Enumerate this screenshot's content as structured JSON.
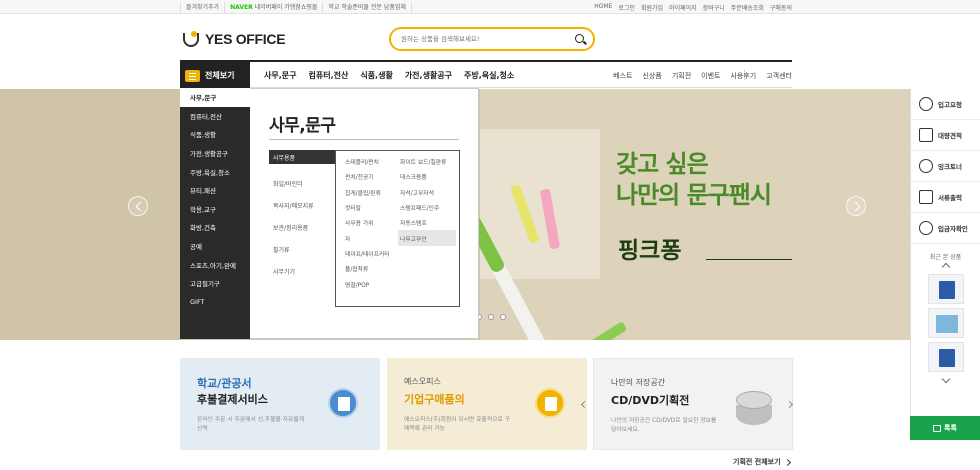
{
  "topbar": {
    "left": [
      "즐겨찾기추가",
      "NAVER",
      "네이버페이 가맹점쇼핑몰",
      "학교 학술준비물 전문 납품업체"
    ],
    "right": [
      "HOME",
      "로그인",
      "회원가입",
      "마이페이지",
      "장바구니",
      "주문배송조회",
      "구매동의"
    ]
  },
  "header": {
    "logo_text": "YES OFFICE",
    "search_placeholder": "원하는 상품을 검색해보세요!"
  },
  "nav": {
    "all_menu": "전체보기",
    "categories": [
      "사무,문구",
      "컴퓨터,전산",
      "식품,생활",
      "가전,생활공구",
      "주방,욕실,청소"
    ],
    "extras": [
      "베스트",
      "신상품",
      "기획전",
      "이벤트",
      "사용후기",
      "고객센터"
    ]
  },
  "category_menu": {
    "items": [
      "사무,문구",
      "컴퓨터,전산",
      "식품,생활",
      "가전,생활공구",
      "주방,욕실,청소",
      "뷰티,패션",
      "학용,교구",
      "화방,건축",
      "공예",
      "스포츠,아기,완예",
      "고급필기구",
      "GIFT"
    ],
    "panel_title": "사무,문구",
    "sub_items": [
      "사무용품",
      "화일/바인더",
      "복사지/메모지류",
      "보관/정리용품",
      "필기류",
      "사무기기"
    ],
    "detail_col1": [
      "스테플러/펀치",
      "펀치/천공기",
      "집게/클립/핀류",
      "컷터칼",
      "사무용 가위",
      "자",
      "테이프/테이프커터",
      "풀/접착류",
      "명찰/POP"
    ],
    "detail_col2": [
      "화이트 보드/칠판류",
      "데스크용품",
      "자석/고무자석",
      "스탬프패드/인주",
      "자동스탬프",
      "나무고무인"
    ]
  },
  "hero": {
    "slogan_line1": "갖고 싶은",
    "slogan_line2": "나만의 문구팬시",
    "brand": "핑크퐁"
  },
  "quick_menu": {
    "items": [
      "입고요청",
      "대량견적",
      "잉크토너",
      "서류출력",
      "입금자확인"
    ],
    "recent_title": "최근 본 상품",
    "talk_label": "톡톡"
  },
  "banners": [
    {
      "line1": "학교/관공서",
      "line2": "후불결제서비스",
      "desc": "온라인 주문 시 주문에서 선,후불을 자유롭게 선택"
    },
    {
      "line1": "예스오피스",
      "line2": "기업구매품의",
      "desc": "예스오피스(주)회원이 되시면 효율적으로 구매목록 관리 가능"
    },
    {
      "line1": "나만의 저장공간",
      "line2": "CD/DVD기획전",
      "desc": "나만의 저장공간 CD/DVD로 필요한 정보를 담아보세요."
    }
  ],
  "more_link": "기획전 전체보기"
}
